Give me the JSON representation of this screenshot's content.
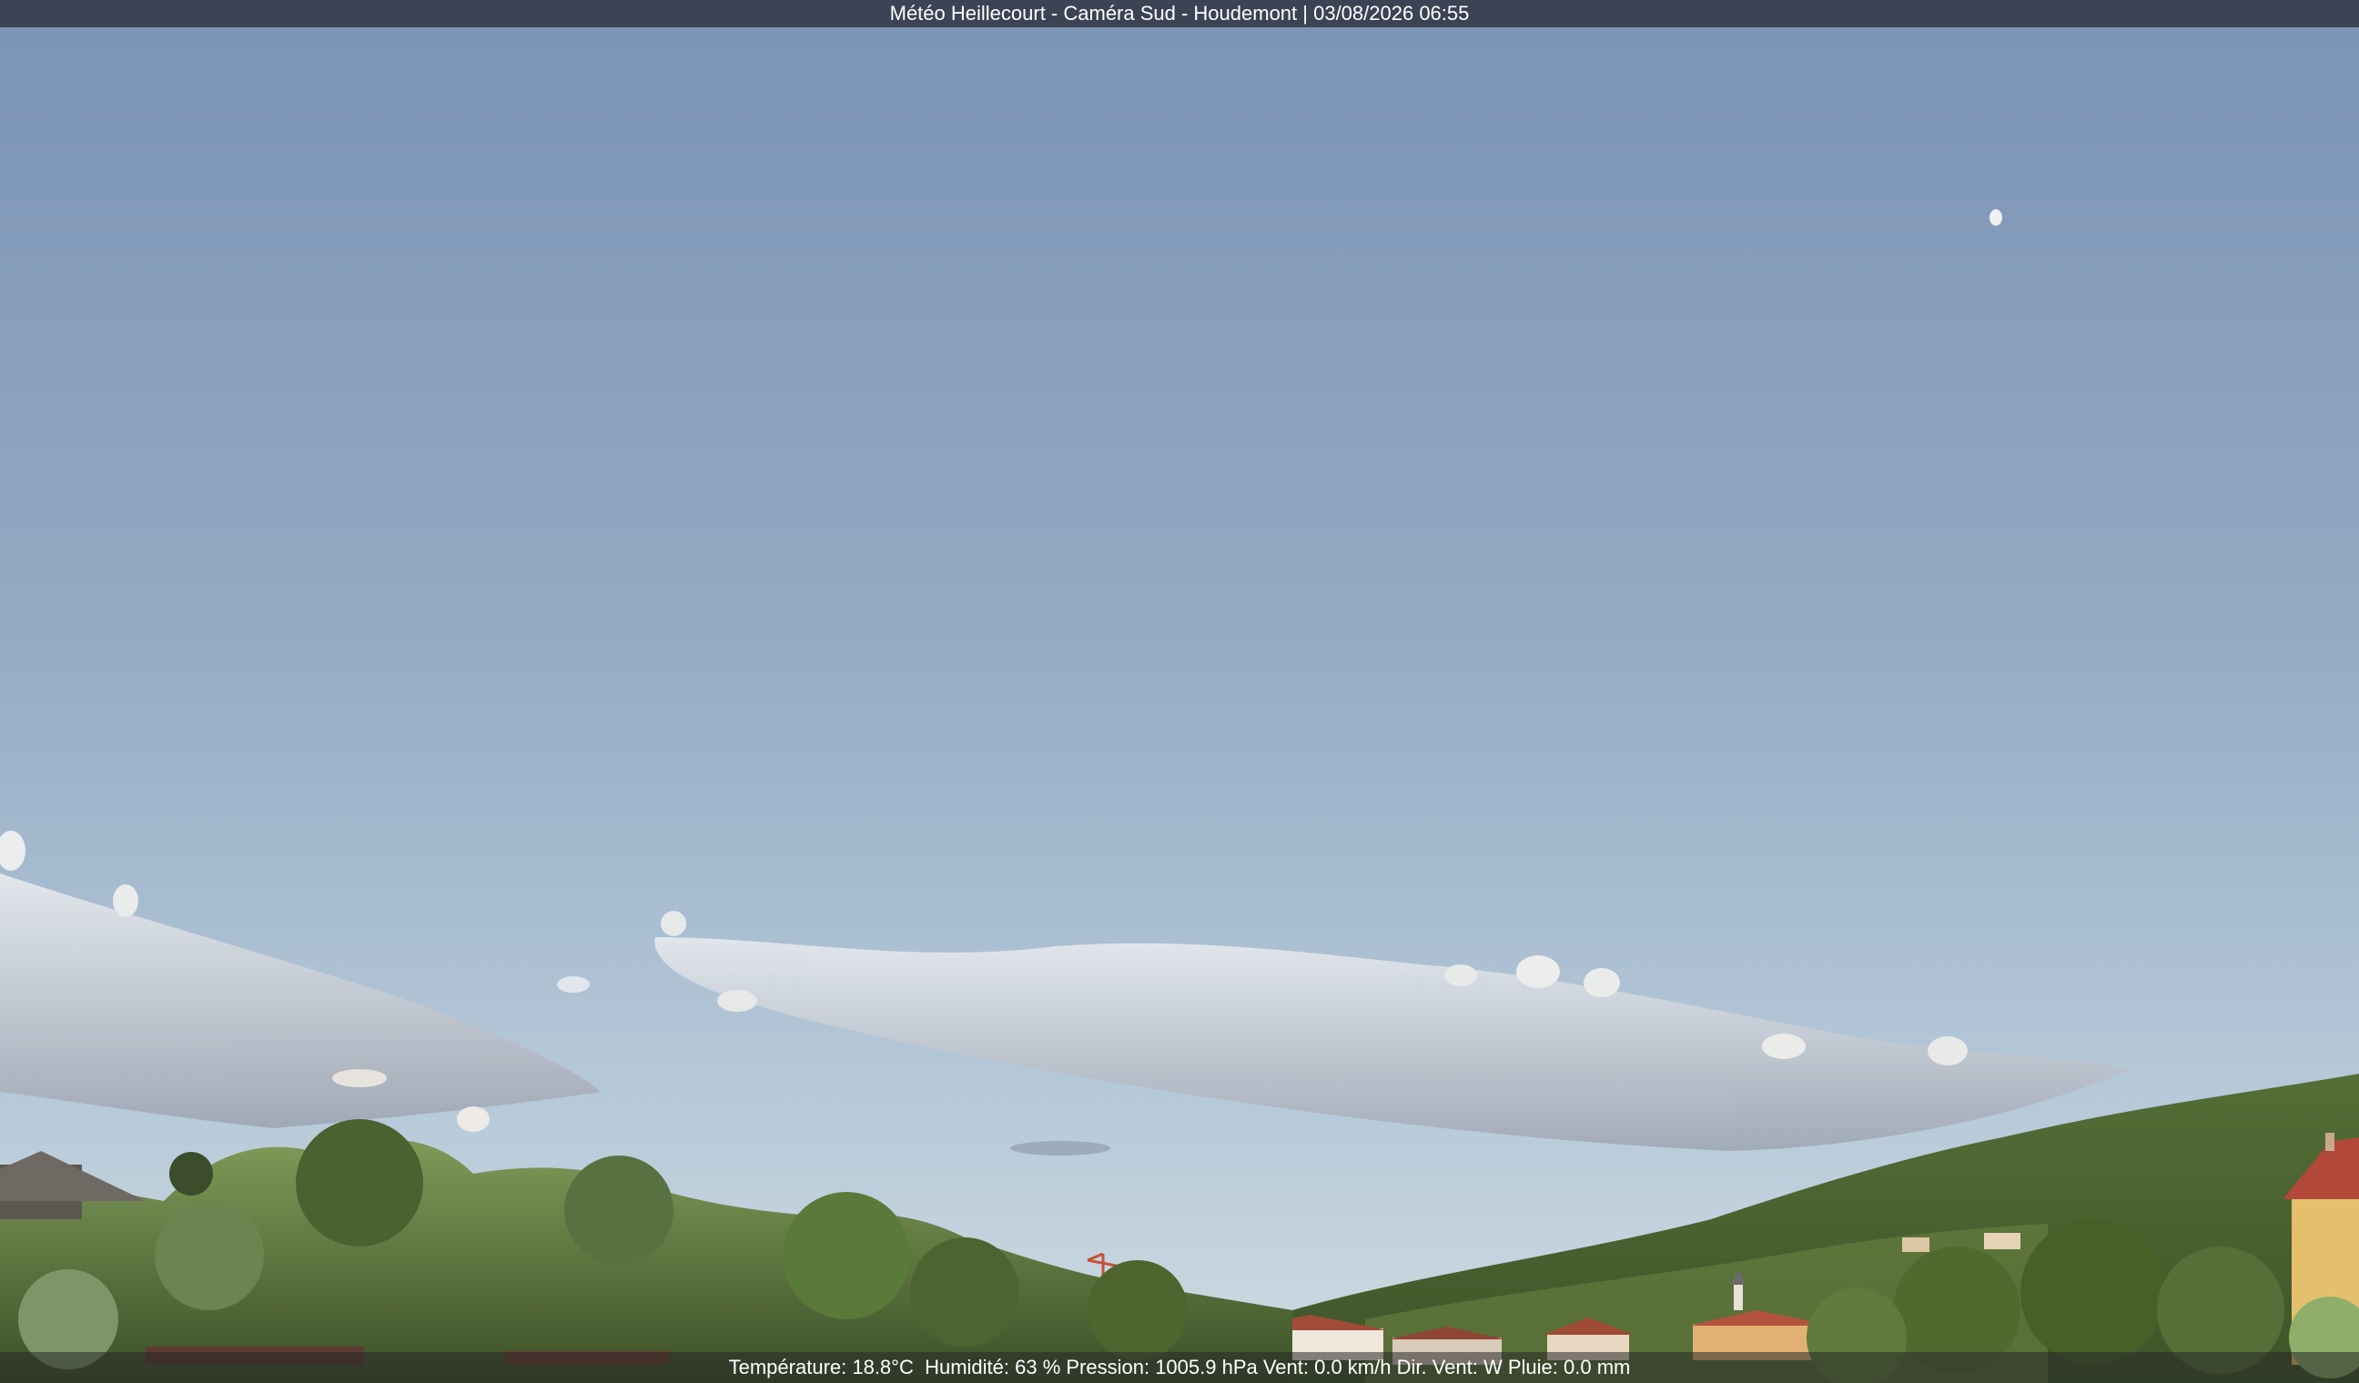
{
  "camera": {
    "title": "Météo Heillecourt - Caméra Sud - Houdemont | 03/08/2026 06:55"
  },
  "weather": {
    "overlay": "Température: 18.8°C  Humidité: 63 % Pression: 1005.9 hPa Vent: 0.0 km/h Dir. Vent: W Pluie: 0.0 mm"
  },
  "colors": {
    "title_bar": "#3b4354",
    "sky_top": "#7b93b5",
    "sky_bottom": "#c2d4e2",
    "foliage": "#4f6a33"
  }
}
